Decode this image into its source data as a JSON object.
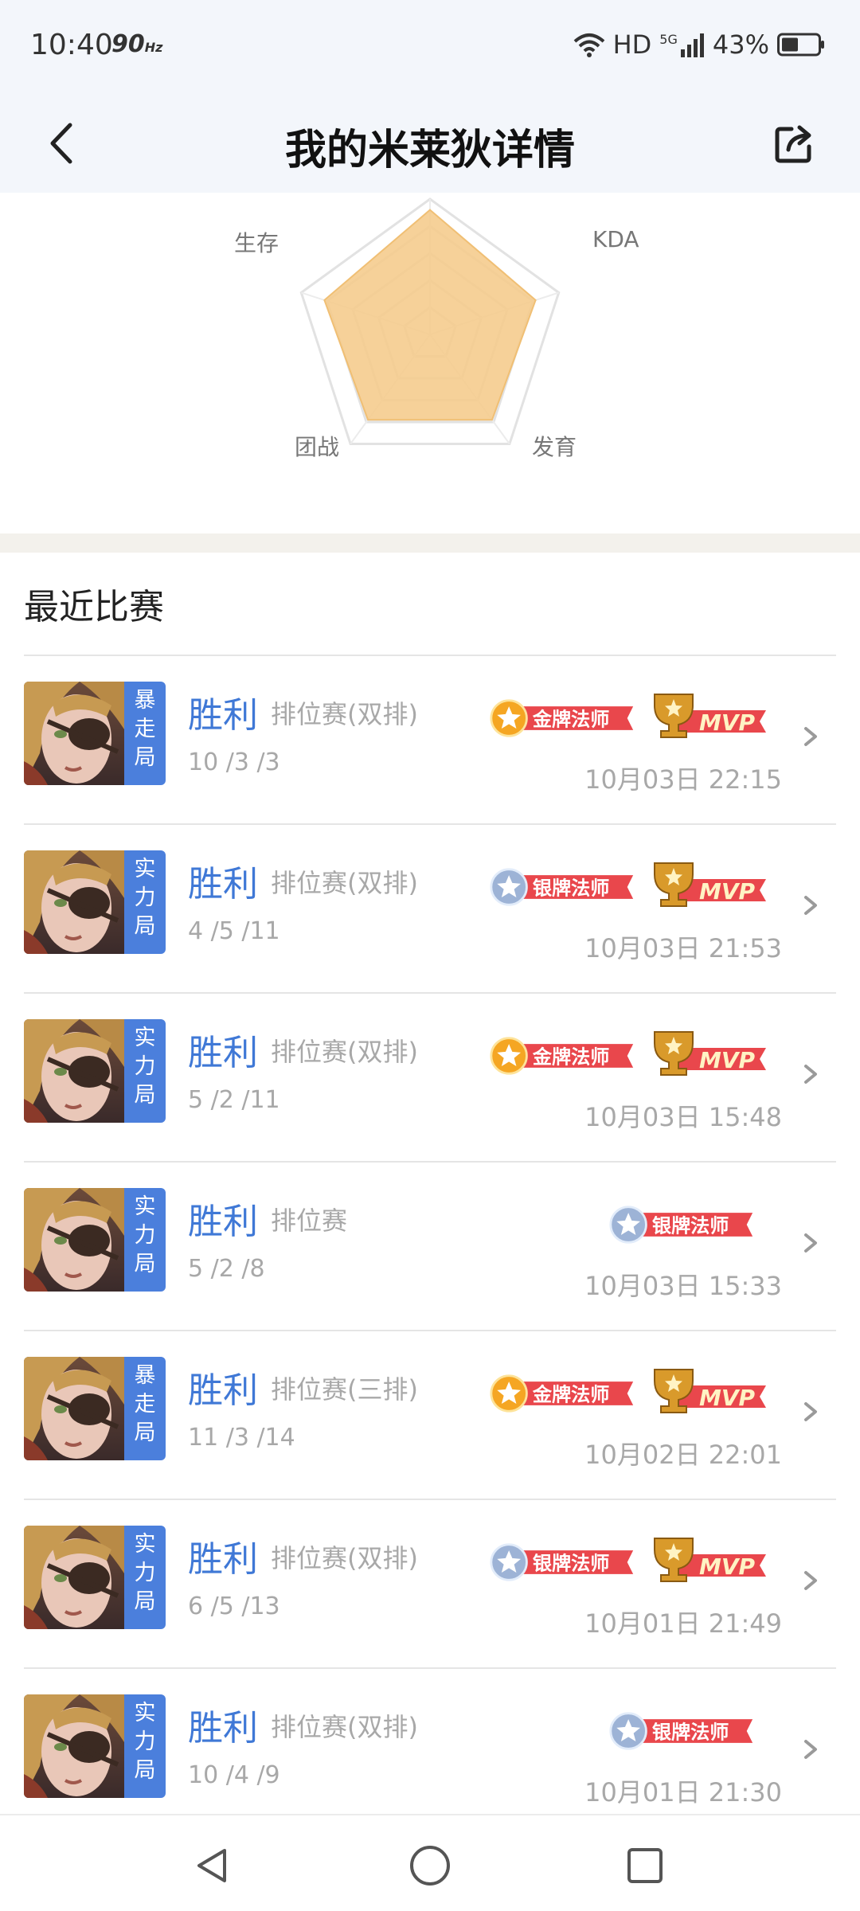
{
  "status_bar": {
    "time": "10:40",
    "refresh_rate": "90",
    "refresh_unit": "Hz",
    "network_hd": "HD",
    "network_5g": "5G",
    "battery": "43%"
  },
  "header": {
    "title": "我的米莱狄详情",
    "back_icon": "back-arrow-icon",
    "share_icon": "share-icon"
  },
  "radar": {
    "labels": {
      "survival": "生存",
      "kda": "KDA",
      "teamfight": "团战",
      "farming": "发育"
    },
    "values": {
      "top": 0.92,
      "kda": 0.82,
      "farming": 0.78,
      "teamfight": 0.78,
      "survival": 0.82
    },
    "fill_color": "#f5cc8e"
  },
  "recent": {
    "title": "最近比赛",
    "matches": [
      {
        "tag": "暴走局",
        "result": "胜利",
        "mode": "排位赛(双排)",
        "kda": "10 /3 /3",
        "medal": "金牌法师",
        "medal_tier": "gold",
        "mvp": "MVP",
        "time": "10月03日 22:15"
      },
      {
        "tag": "实力局",
        "result": "胜利",
        "mode": "排位赛(双排)",
        "kda": "4 /5 /11",
        "medal": "银牌法师",
        "medal_tier": "silver",
        "mvp": "MVP",
        "time": "10月03日 21:53"
      },
      {
        "tag": "实力局",
        "result": "胜利",
        "mode": "排位赛(双排)",
        "kda": "5 /2 /11",
        "medal": "金牌法师",
        "medal_tier": "gold",
        "mvp": "MVP",
        "time": "10月03日 15:48"
      },
      {
        "tag": "实力局",
        "result": "胜利",
        "mode": "排位赛",
        "kda": "5 /2 /8",
        "medal": "银牌法师",
        "medal_tier": "silver",
        "mvp": "",
        "time": "10月03日 15:33"
      },
      {
        "tag": "暴走局",
        "result": "胜利",
        "mode": "排位赛(三排)",
        "kda": "11 /3 /14",
        "medal": "金牌法师",
        "medal_tier": "gold",
        "mvp": "MVP",
        "time": "10月02日 22:01"
      },
      {
        "tag": "实力局",
        "result": "胜利",
        "mode": "排位赛(双排)",
        "kda": "6 /5 /13",
        "medal": "银牌法师",
        "medal_tier": "silver",
        "mvp": "MVP",
        "time": "10月01日 21:49"
      },
      {
        "tag": "实力局",
        "result": "胜利",
        "mode": "排位赛(双排)",
        "kda": "10 /4 /9",
        "medal": "银牌法师",
        "medal_tier": "silver",
        "mvp": "",
        "time": "10月01日 21:30"
      }
    ]
  },
  "colors": {
    "accent_blue": "#3f78d6",
    "tag_blue": "#4b7fdc",
    "badge_red": "#e9474c",
    "gold": "#f5a623",
    "silver": "#9db3d6",
    "muted_text": "#a8a8a8"
  },
  "nav": {
    "back": "nav-back-icon",
    "home": "nav-home-icon",
    "recents": "nav-recents-icon"
  }
}
